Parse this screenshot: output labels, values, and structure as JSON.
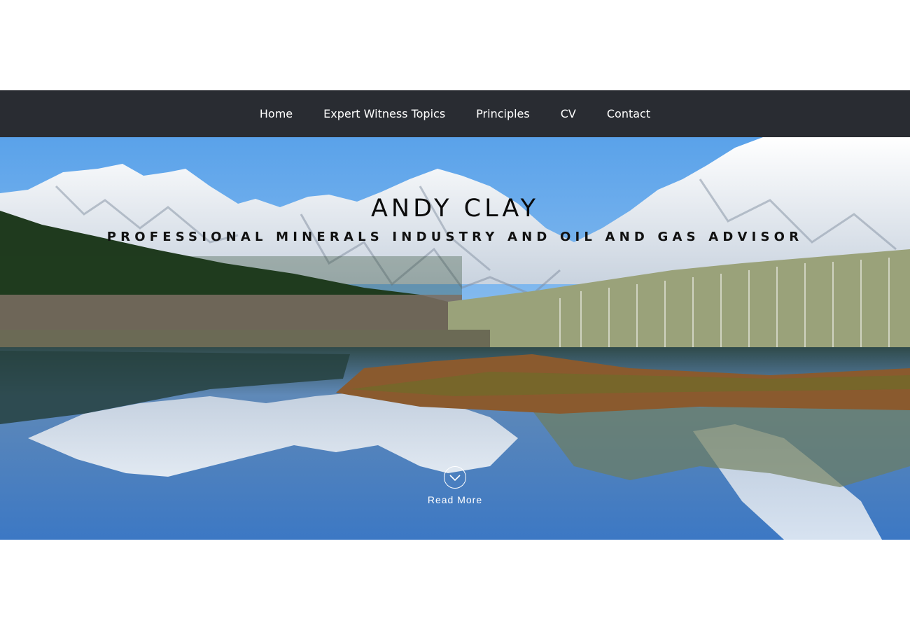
{
  "nav": {
    "items": [
      {
        "label": "Home"
      },
      {
        "label": "Expert Witness Topics"
      },
      {
        "label": "Principles"
      },
      {
        "label": "CV"
      },
      {
        "label": "Contact"
      }
    ]
  },
  "hero": {
    "title": "ANDY CLAY",
    "subtitle": "PROFESSIONAL MINERALS INDUSTRY AND OIL AND GAS ADVISOR",
    "read_more_label": "Read More",
    "read_more_icon": "chevron-down-circle-icon",
    "background": "mountain-lake-landscape"
  },
  "colors": {
    "navbar_bg": "#292c32",
    "nav_text": "#ffffff",
    "sky": "#5aa0e6",
    "water": "#3f7fc8"
  }
}
